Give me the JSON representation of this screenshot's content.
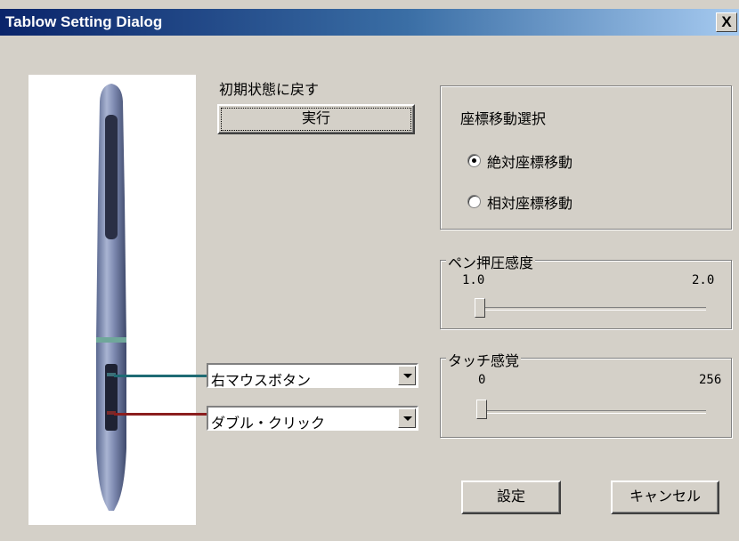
{
  "window": {
    "title": "Tablow Setting Dialog",
    "close": "X"
  },
  "reset": {
    "label": "初期状態に戻す",
    "button": "実行"
  },
  "coord_group": {
    "title": "座標移動選択",
    "options": [
      {
        "label": "絶対座標移動",
        "selected": true
      },
      {
        "label": "相対座標移動",
        "selected": false
      }
    ]
  },
  "pressure": {
    "title": "ペン押圧感度",
    "min": "1.0",
    "max": "2.0"
  },
  "touch": {
    "title": "タッチ感覚",
    "min": "0",
    "max": "256"
  },
  "buttons": {
    "upper": {
      "value": "右マウスボタン",
      "color": "#1f6b74"
    },
    "lower": {
      "value": "ダブル・クリック",
      "color": "#8b1e1e"
    }
  },
  "footer": {
    "ok": "設定",
    "cancel": "キャンセル"
  }
}
